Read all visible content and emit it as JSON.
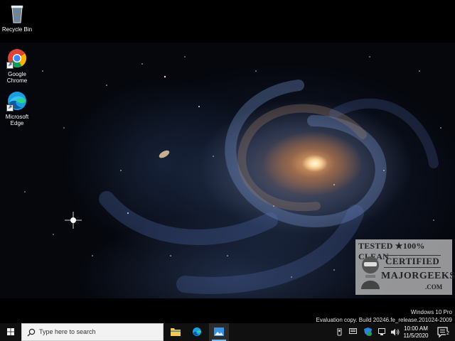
{
  "desktop_icons": [
    {
      "label_lines": [
        "Recycle Bin"
      ],
      "icon": "recycle-bin-icon"
    },
    {
      "label_lines": [
        "Google",
        "Chrome"
      ],
      "icon": "chrome-icon"
    },
    {
      "label_lines": [
        "Microsoft",
        "Edge"
      ],
      "icon": "edge-icon"
    }
  ],
  "watermark": {
    "line1": "TESTED ★100% CLEAN",
    "line2": "CERTIFIED",
    "brand": "MAJORGEEKS",
    "suffix": ".COM"
  },
  "activation": {
    "edition": "Windows 10 Pro",
    "build": "Evaluation copy. Build 20246.fe_release.201024-2009"
  },
  "taskbar": {
    "start_icon": "windows-logo-icon",
    "search_placeholder": "Type here to search",
    "pinned_apps": [
      "file-explorer-icon",
      "edge-icon",
      "image-viewer-icon"
    ],
    "tray_icons": [
      "people-icon",
      "keyboard-icon",
      "defender-icon",
      "network-icon",
      "volume-icon"
    ],
    "clock_time": "10:00 AM",
    "clock_date": "11/5/2020",
    "notification_count": "2",
    "accent_color": "#76b9ed"
  }
}
